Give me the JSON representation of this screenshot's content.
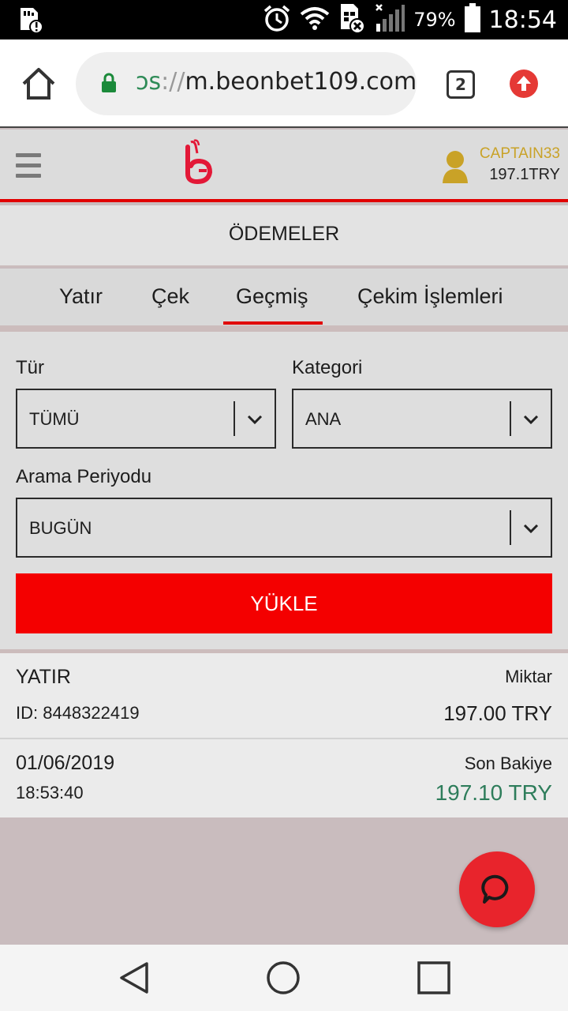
{
  "status_bar": {
    "battery_percent": "79%",
    "time": "18:54",
    "icons": [
      "sd-card-warning-icon",
      "alarm-icon",
      "wifi-icon",
      "sim-off-icon",
      "signal-icon",
      "battery-icon"
    ]
  },
  "browser": {
    "url_scheme": "ɔs",
    "url_separator": "://",
    "url_host": "m.beonbet109.com",
    "tab_count": "2",
    "icons": [
      "home-icon",
      "lock-icon",
      "tabs-icon",
      "update-icon"
    ]
  },
  "header": {
    "username": "CAPTAIN33",
    "balance": "197.1TRY",
    "icons": [
      "hamburger-icon",
      "logo-icon",
      "user-avatar-icon"
    ]
  },
  "payments": {
    "title": "ÖDEMELER",
    "tabs": [
      {
        "label": "Yatır"
      },
      {
        "label": "Çek"
      },
      {
        "label": "Geçmiş"
      },
      {
        "label": "Çekim İşlemleri"
      }
    ],
    "active_tab": "Geçmiş"
  },
  "filters": {
    "type_label": "Tür",
    "type_value": "TÜMÜ",
    "category_label": "Kategori",
    "category_value": "ANA",
    "period_label": "Arama Periyodu",
    "period_value": "BUGÜN",
    "load_button": "YÜKLE"
  },
  "transaction": {
    "type": "YATIR",
    "id": "ID: 8448322419",
    "amount_label": "Miktar",
    "amount": "197.00 TRY",
    "date": "01/06/2019",
    "time": "18:53:40",
    "balance_label": "Son Bakiye",
    "balance": "197.10 TRY"
  },
  "colors": {
    "brand_red": "#f40000",
    "username_gold": "#c9a227",
    "balance_green": "#2e7d5b",
    "chat_red": "#e8242c"
  },
  "nav": {
    "icons": [
      "back-icon",
      "home-circle-icon",
      "recents-icon"
    ]
  }
}
